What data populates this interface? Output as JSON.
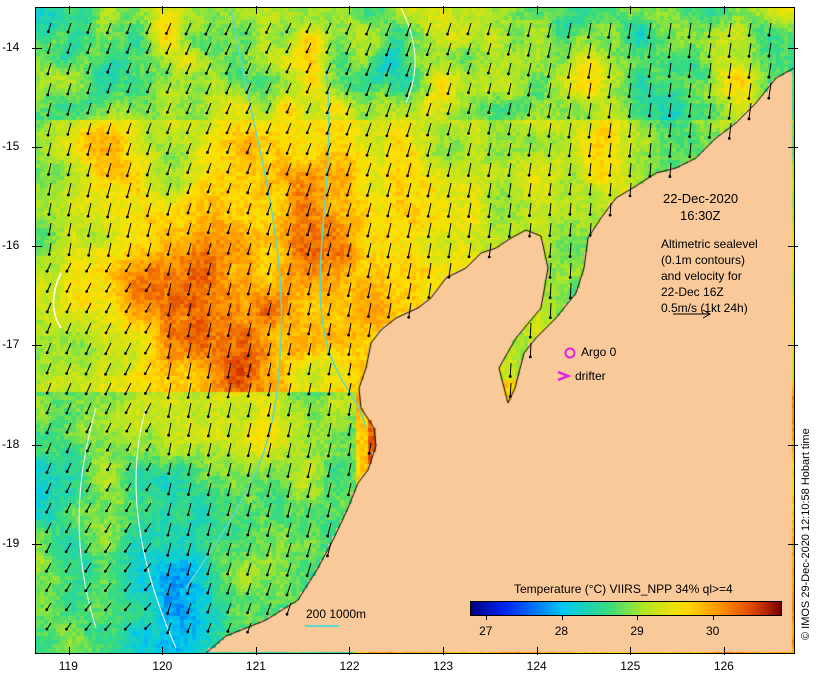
{
  "map": {
    "lat_ticks": [
      "-14",
      "-15",
      "-16",
      "-17",
      "-18",
      "-19"
    ],
    "lon_ticks": [
      "119",
      "120",
      "121",
      "122",
      "123",
      "124",
      "125",
      "126"
    ],
    "lat_range": [
      -20.1,
      -13.6
    ],
    "lon_range": [
      118.65,
      126.75
    ]
  },
  "info": {
    "date": "22-Dec-2020",
    "time": "16:30Z",
    "altimetry_lines": [
      "Altimetric sealevel",
      "(0.1m contours)",
      "and velocity for",
      "22-Dec 16Z",
      "0.5m/s (1kt 24h)"
    ]
  },
  "markers": {
    "argo_label": "Argo 0",
    "argo_color": "#e020e0",
    "drifter_label": "drifter",
    "drifter_color": "#e020e0"
  },
  "colorbar": {
    "title": "Temperature (°C) VIIRS_NPP 34% ql>=4",
    "ticks": [
      "27",
      "28",
      "29",
      "30"
    ],
    "range": [
      26.8,
      30.9
    ]
  },
  "depth_legend": "200  1000m",
  "credit": "© IMOS 29-Dec-2020 12:10:58 Hobart time",
  "colors": {
    "land": "#f9c99a",
    "depth_contour": "#5fd8c8",
    "sealevel_contour": "#ffffff",
    "arrow": "#000000"
  }
}
